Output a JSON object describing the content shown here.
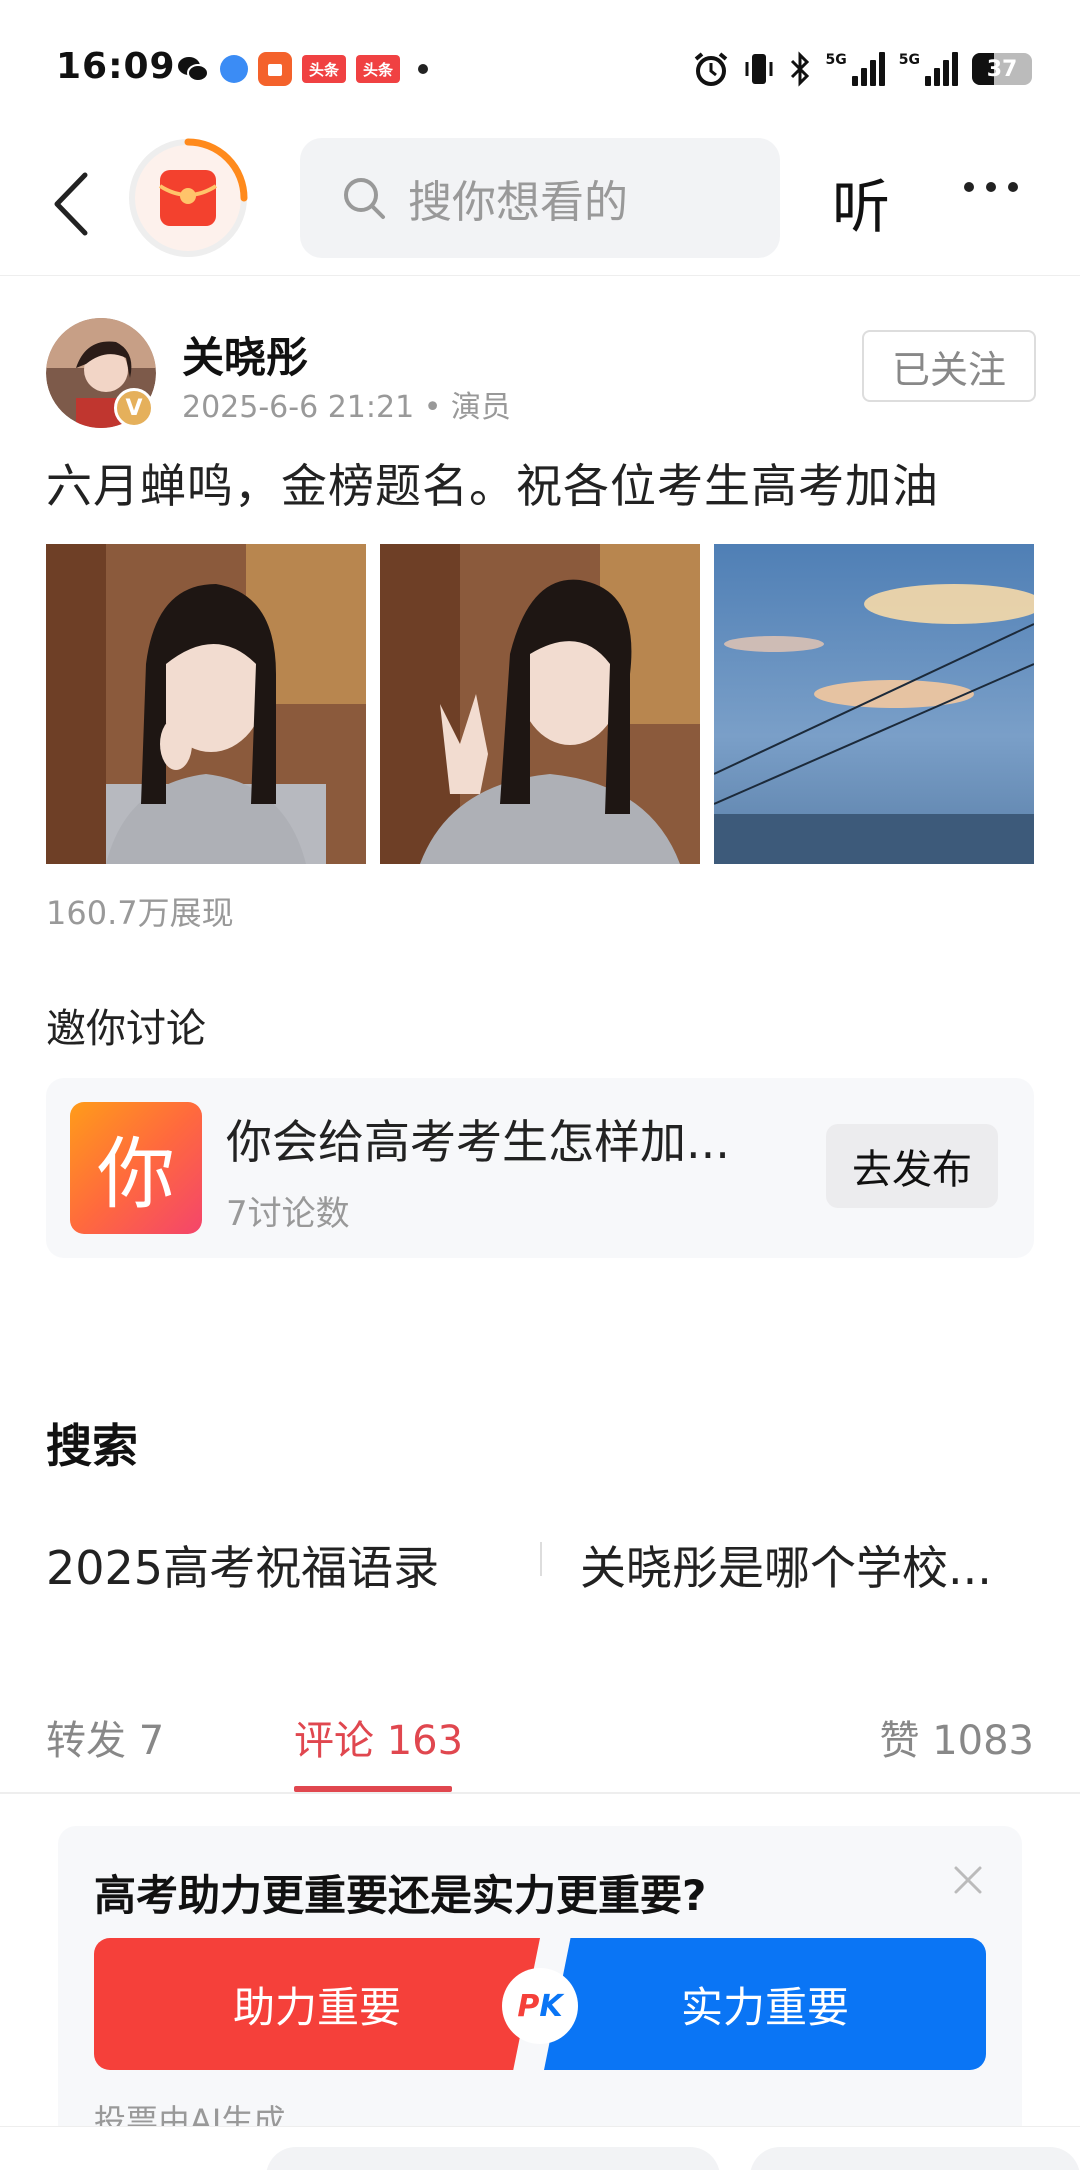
{
  "status_bar": {
    "time": "16:09",
    "app_label_toutiao": "头条",
    "network_1": "5G",
    "network_2": "5G",
    "battery": "37",
    "battery_level": 0.37
  },
  "nav": {
    "search_placeholder": "搜你想看的",
    "listen_label": "听"
  },
  "post": {
    "author": "关晓彤",
    "verified_badge": "V",
    "meta": "2025-6-6 21:21 • 演员",
    "follow_label": "已关注",
    "text": "六月蝉鸣，金榜题名。祝各位考生高考加油",
    "views": "160.7万展现"
  },
  "discussion": {
    "section_title": "邀你讨论",
    "icon_char": "你",
    "topic": "你会给高考考生怎样加...",
    "count": "7讨论数",
    "publish_label": "去发布"
  },
  "search": {
    "section_title": "搜索",
    "items": [
      "2025高考祝福语录",
      "关晓彤是哪个学校..."
    ]
  },
  "tabs": {
    "repost": "转发 7",
    "comment": "评论 163",
    "likes": "赞 1083"
  },
  "vote": {
    "question": "高考助力更重要还是实力更重要?",
    "option_left": "助力重要",
    "option_right": "实力重要",
    "pk_p": "P",
    "pk_k": "K",
    "note": "投票由AI生成"
  },
  "colors": {
    "accent_red": "#e0474f",
    "vote_red": "#f5403a",
    "vote_blue": "#0a75f5"
  }
}
